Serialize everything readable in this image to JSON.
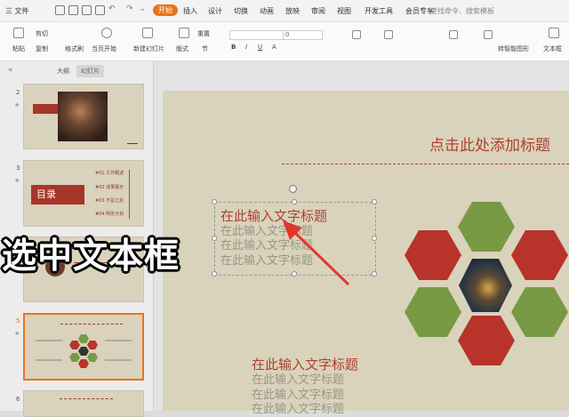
{
  "menubar": {
    "file_label": "三 文件",
    "tabs": [
      "开始",
      "插入",
      "设计",
      "切换",
      "动画",
      "放映",
      "审阅",
      "视图",
      "开发工具",
      "会员专享"
    ],
    "search_placeholder": "查找命令、搜索模板"
  },
  "ribbon": {
    "paste": "粘贴",
    "cut": "剪切",
    "copy": "复制",
    "format_painter": "格式刷",
    "play_from_current": "当页开始",
    "new_slide": "新建幻灯片",
    "layout": "版式",
    "section": "节",
    "reset": "重置",
    "font_size": "0",
    "to_smartart": "转智能图形",
    "textbox": "文本框"
  },
  "leftpanel": {
    "tab_outline": "大纲",
    "tab_slides": "幻灯片",
    "slide_numbers": [
      "2",
      "3",
      "4",
      "5",
      "6"
    ],
    "toc_title": "目录",
    "toc_items": [
      "#01 工作概述",
      "#02 成果展示",
      "#03 不足之处",
      "#04 明年计划"
    ]
  },
  "slide": {
    "title_placeholder": "点击此处添加标题",
    "block1": {
      "title": "在此输入文字标题",
      "lines": [
        "在此输入文字标题",
        "在此输入文字标题",
        "在此输入文字标题"
      ]
    },
    "block2": {
      "title": "在此输入文字标题",
      "lines": [
        "在此输入文字标题",
        "在此输入文字标题",
        "在此输入文字标题"
      ]
    }
  },
  "overlay_caption": "选中文本框",
  "colors": {
    "accent": "#e8731f",
    "slide_red": "#b04032",
    "hex_red": "#b8342a",
    "hex_green": "#789a44",
    "slide_bg": "#d9d3bc"
  }
}
